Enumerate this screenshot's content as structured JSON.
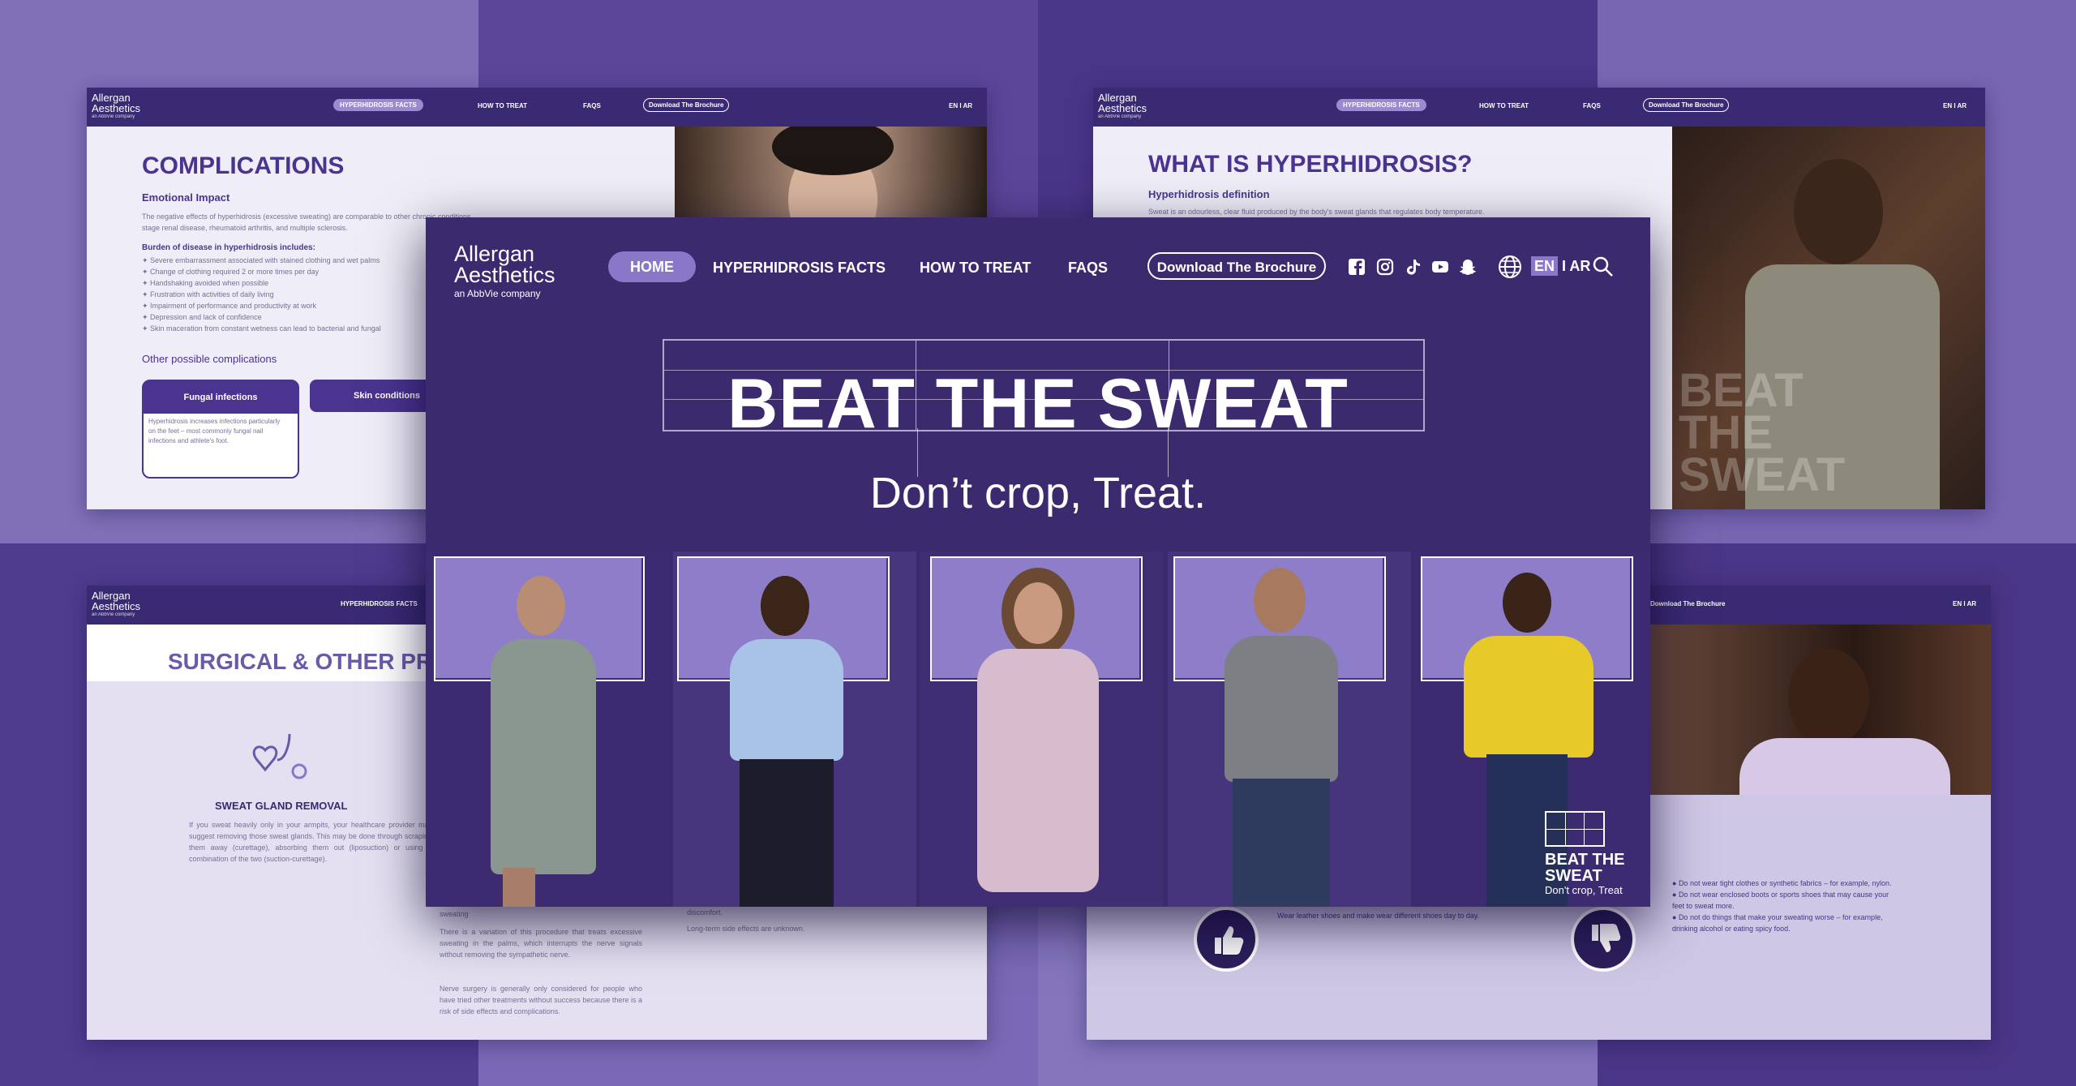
{
  "colors": {
    "brand_purple": "#3c2a6e",
    "accent_lilac": "#8a77c8",
    "title_purple": "#4b3490",
    "panel_bg": "#efedf7"
  },
  "main": {
    "logo": {
      "line1": "Allergan",
      "line2": "Aesthetics",
      "sub": "an AbbVie company"
    },
    "nav": {
      "home": "HOME",
      "facts": "HYPERHIDROSIS FACTS",
      "treat": "HOW TO TREAT",
      "faqs": "FAQS",
      "brochure": "Download The Brochure"
    },
    "social_icons": [
      "facebook-icon",
      "instagram-icon",
      "tiktok-icon",
      "youtube-icon",
      "snapchat-icon"
    ],
    "lang": {
      "en": "EN",
      "sep": "I",
      "ar": "AR"
    },
    "hero": {
      "title": "BEAT THE SWEAT",
      "subtitle": "Don’t crop, Treat."
    },
    "badge": {
      "line1": "BEAT THE",
      "line2": "SWEAT",
      "line3": "Don't crop, Treat"
    }
  },
  "panel_tl": {
    "logo": {
      "line1": "Allergan",
      "line2": "Aesthetics",
      "sub": "an AbbVie company"
    },
    "nav": {
      "facts": "HYPERHIDROSIS FACTS",
      "treat": "HOW TO TREAT",
      "faqs": "FAQS",
      "brochure": "Download The Brochure",
      "lang": "EN I AR"
    },
    "title": "COMPLICATIONS",
    "subtitle": "Emotional Impact",
    "intro": "The negative effects of hyperhidrosis (excessive sweating) are comparable to other chronic conditions,",
    "intro2": "stage renal disease, rheumatoid arthritis, and multiple sclerosis.",
    "burden_title": "Burden of disease in hyperhidrosis includes:",
    "burden": [
      "Severe embarrassment associated with stained clothing and wet palms",
      "Change of clothing required 2 or more times per day",
      "Handshaking avoided when possible",
      "Frustration with activities of daily living",
      "Impairment of performance and productivity at work",
      "Depression and lack of confidence",
      "Skin maceration from constant wetness can lead to bacterial and fungal"
    ],
    "other_title": "Other possible complications",
    "tab1": "Fungal infections",
    "tab2": "Skin conditions",
    "tab1_text": "Hyperhidrosis increases infections particularly on the feet – most commonly fungal nail infections and athlete's foot."
  },
  "panel_tr": {
    "logo": {
      "line1": "Allergan",
      "line2": "Aesthetics",
      "sub": "an AbbVie company"
    },
    "nav": {
      "facts": "HYPERHIDROSIS FACTS",
      "treat": "HOW TO TREAT",
      "faqs": "FAQS",
      "brochure": "Download The Brochure",
      "lang": "EN I AR"
    },
    "title": "WHAT IS HYPERHIDROSIS?",
    "subtitle": "Hyperhidrosis definition",
    "text": "Sweat is an odourless, clear fluid produced by the body's sweat glands that regulates body temperature.",
    "watermark": [
      "BEAT",
      "THE",
      "SWEAT"
    ]
  },
  "panel_bl": {
    "logo": {
      "line1": "Allergan",
      "line2": "Aesthetics",
      "sub": "an AbbVie company"
    },
    "nav": {
      "facts": "HYPERHIDROSIS FACTS"
    },
    "title": "SURGICAL & OTHER PR",
    "section": "SWEAT GLAND REMOVAL",
    "section_text": "If you sweat heavily only in your armpits, your healthcare provider may suggest removing those sweat glands. This may be done through scraping them away (curettage), absorbing them out (liposuction) or using a combination of the two (suction-curettage).",
    "label": "sweating",
    "para1": "There is a variation of this procedure that treats excessive sweating in the palms, which interrupts the nerve signals without removing the sympathetic nerve.",
    "para2": "Nerve surgery is generally only considered for people who have tried other treatments without success because there is a risk of side effects and complications.",
    "extra1": "discomfort.",
    "extra2": "Long-term side effects are unknown."
  },
  "panel_br": {
    "nav": {
      "brochure": "Download The Brochure",
      "lang": "EN I AR"
    },
    "left_items": [
      "Wear leather shoes and make wear different shoes day to day."
    ],
    "tips": [
      "Do not wear tight clothes or synthetic fabrics – for example, nylon.",
      "Do not wear enclosed boots or sports shoes that may cause your feet to sweat more.",
      "Do not do things that make your sweating worse – for example, drinking alcohol or eating spicy food."
    ]
  }
}
